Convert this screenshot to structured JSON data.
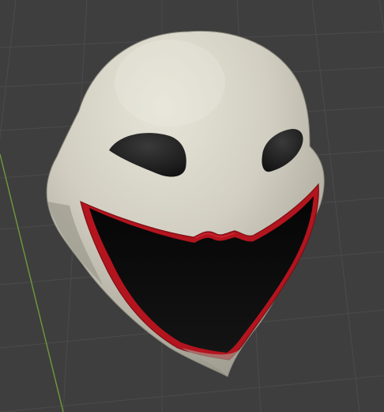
{
  "viewport": {
    "background_color": "#3e3e3e",
    "grid_line_color": "#4a4a4a",
    "y_axis_color": "#6f9a3a"
  },
  "model": {
    "subject": "3D mask model",
    "surface_color": "#d4d1c4",
    "mouth_outline_color": "#b3141e",
    "mouth_interior_color": "#0c0c0c",
    "eye_interior_color": "#1a1a1a"
  }
}
